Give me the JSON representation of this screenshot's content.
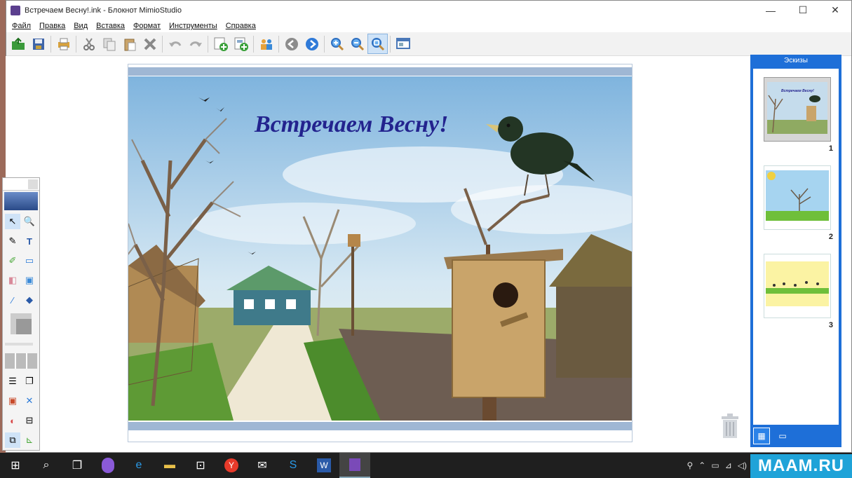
{
  "window": {
    "title": "Встречаем Весну!.ink - Блокнот MimioStudio",
    "minimize": "—",
    "maximize": "☐",
    "close": "✕"
  },
  "menu": [
    "Файл",
    "Правка",
    "Вид",
    "Вставка",
    "Формат",
    "Инструменты",
    "Справка"
  ],
  "toolbar_icons": [
    "open-icon",
    "save-icon",
    "print-icon",
    "cut-icon",
    "copy-icon",
    "paste-icon",
    "delete-icon",
    "undo-icon",
    "redo-icon",
    "new-page-icon",
    "insert-page-icon",
    "collaborate-icon",
    "back-icon",
    "forward-icon",
    "zoom-in-icon",
    "zoom-out-icon",
    "zoom-fit-icon",
    "screen-icon"
  ],
  "slide": {
    "title": "Встречаем Весну!"
  },
  "sidebar": {
    "header": "Эскизы",
    "thumbs": [
      {
        "num": "1",
        "label": "Встречаем Весну!"
      },
      {
        "num": "2"
      },
      {
        "num": "3"
      }
    ]
  },
  "watermark": "MAAM.RU"
}
